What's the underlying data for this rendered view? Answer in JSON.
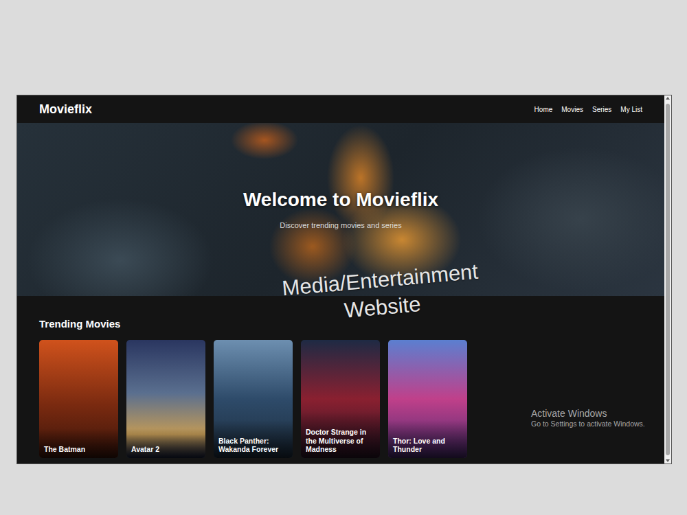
{
  "site": {
    "brand": "Movieflix",
    "nav": [
      {
        "label": "Home"
      },
      {
        "label": "Movies"
      },
      {
        "label": "Series"
      },
      {
        "label": "My List"
      }
    ]
  },
  "hero": {
    "title": "Welcome to Movieflix",
    "subtitle": "Discover trending movies and series"
  },
  "section": {
    "title": "Trending Movies",
    "movies": [
      {
        "title": "The Batman"
      },
      {
        "title": "Avatar 2"
      },
      {
        "title": "Black Panther: Wakanda Forever"
      },
      {
        "title": "Doctor Strange in the Multiverse of Madness"
      },
      {
        "title": "Thor: Love and Thunder"
      }
    ]
  },
  "overlay_caption": "Media/Entertainment Website",
  "watermark": {
    "title": "Activate Windows",
    "subtitle": "Go to Settings to activate Windows."
  }
}
